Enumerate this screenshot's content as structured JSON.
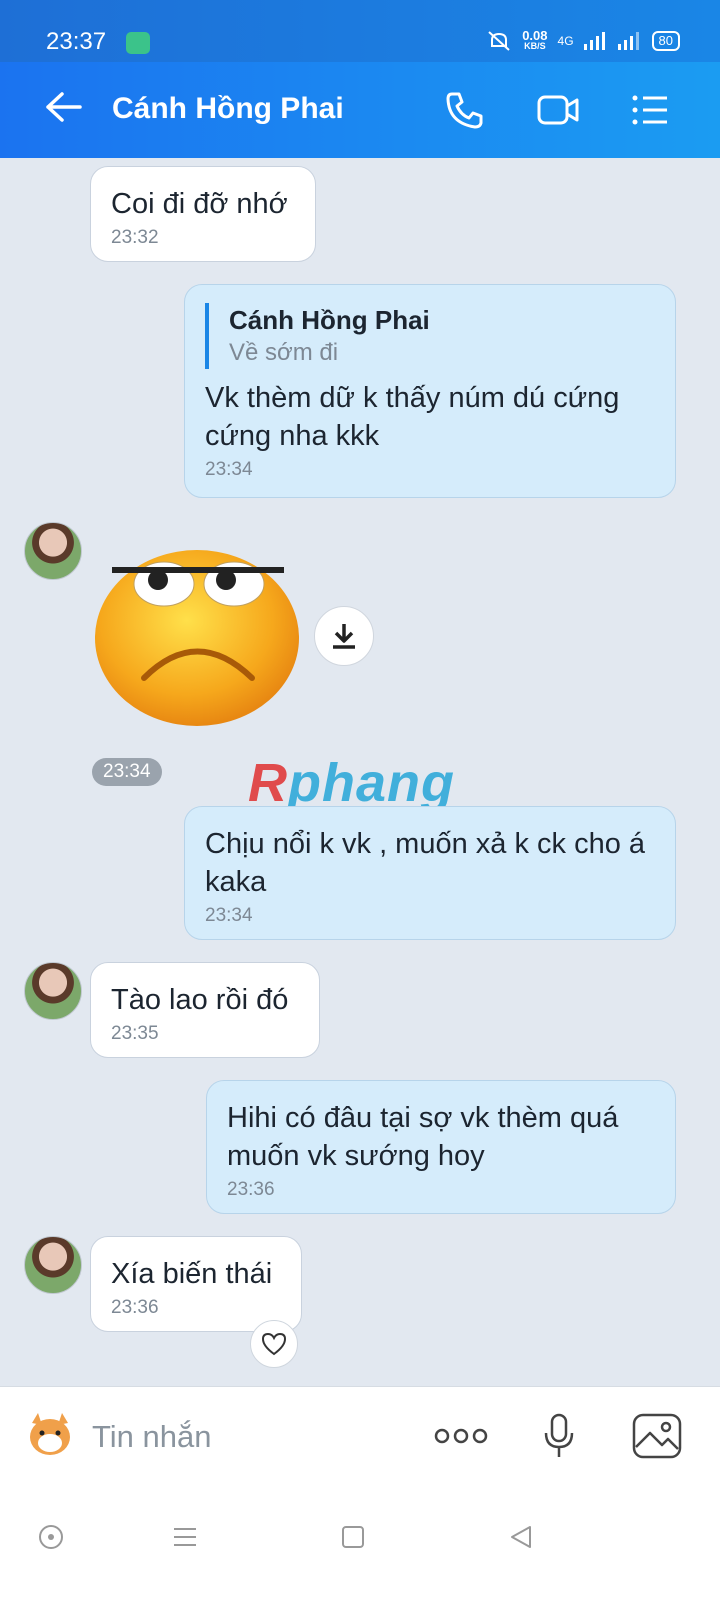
{
  "status_bar": {
    "time": "23:37",
    "speed_value": "0.08",
    "speed_unit": "KB/S",
    "network": "4G",
    "battery": "80"
  },
  "header": {
    "title": "Cánh Hồng Phai",
    "icons": [
      "back-arrow-icon",
      "phone-icon",
      "video-icon",
      "menu-list-icon"
    ]
  },
  "messages": [
    {
      "side": "them",
      "text": "Coi đi đỡ nhớ",
      "time": "23:32"
    },
    {
      "side": "me",
      "quote_name": "Cánh Hồng Phai",
      "quote_text": "Về sớm đi",
      "text": "Vk thèm dữ k thấy núm dú cứng cứng nha kkk",
      "time": "23:34"
    },
    {
      "side": "them",
      "type": "sticker",
      "time": "23:34"
    },
    {
      "side": "me",
      "text": "Chịu nổi k vk , muốn xả k ck cho á kaka",
      "time": "23:34"
    },
    {
      "side": "them",
      "text": "Tào lao rồi đó",
      "time": "23:35"
    },
    {
      "side": "me",
      "text": "Hihi có đâu tại sợ vk thèm quá muốn vk sướng hoy",
      "time": "23:36"
    },
    {
      "side": "them",
      "text": "Xía biến thái",
      "time": "23:36"
    }
  ],
  "watermark": {
    "part1": "R",
    "part2": "phang"
  },
  "composer": {
    "placeholder": "Tin nhắn"
  },
  "colors": {
    "header": "#1b73f0",
    "my_bubble": "#d5ecfb",
    "their_bubble": "#ffffff",
    "background": "#e2e8f0"
  }
}
